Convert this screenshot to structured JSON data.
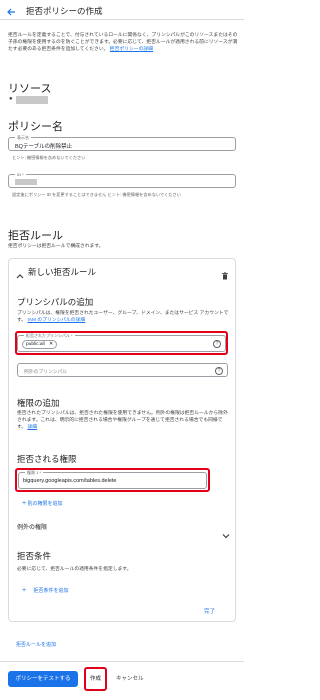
{
  "header": {
    "back_icon": "arrow-left-icon",
    "title": "拒否ポリシーの作成"
  },
  "intro": {
    "text": "拒否ルールを定義することで、付与されているロールに関係なく、プリンシパルがこのリソースまたはその子孫の権限を使用するのを防ぐことができます。必要に応じて、拒否ルールが適用される前にリソースが満たす必要のある拒否条件を追加してください。",
    "link": "拒否ポリシーの詳細"
  },
  "resource": {
    "heading": "リソース"
  },
  "policy_name": {
    "heading": "ポリシー名",
    "display_name_label": "表示名",
    "display_name_value": "BQテーブルの削除禁止",
    "display_name_hint": "ヒント: 機密情報を含めないでください",
    "id_label": "ID *",
    "id_hint": "設定後にポリシー ID を変更することはできません ヒント: 機密情報を含めないでください"
  },
  "deny_rules": {
    "heading": "拒否ルール",
    "description": "拒否ポリシーは拒否ルールで構成されます。",
    "new_rule_title": "新しい拒否ルール",
    "delete_icon": "trash-icon",
    "collapse_icon": "chevron-up-icon"
  },
  "principals": {
    "heading": "プリンシパルの追加",
    "text": "プリンシパルは、権限を拒否されたユーザー、グループ、ドメイン、またはサービス アカウントです。",
    "link": "IAM のプリンシパルの詳細",
    "denied_label": "拒否されたプリンシパル *",
    "chip_value": "public:all",
    "exception_placeholder": "例外のプリンシパル"
  },
  "permissions": {
    "heading": "権限の追加",
    "text": "拒否されたプリンシパルは、拒否された権限を使用できません。例外の権限は拒否ルールから除外されます。これは、明示的に拒否される場合や権限グループを通じて拒否される場合でも同様です。",
    "link": "詳細",
    "denied_heading": "拒否される権限",
    "permission_label": "権限 1 *",
    "permission_value": "bigquery.googleapis.com/tables.delete",
    "add_permission": "別の権限を追加",
    "exception_heading": "例外の権限"
  },
  "conditions": {
    "heading": "拒否条件",
    "text": "必要に応じて、拒否ルールの適用条件を指定します。",
    "add_condition": "拒否条件を追加",
    "done": "完了"
  },
  "add_rule": "拒否ルールを追加",
  "footer": {
    "test_button": "ポリシーをテストする",
    "create_button": "作成",
    "cancel_button": "キャンセル"
  },
  "colors": {
    "accent": "#1a73e8",
    "highlight": "#e2001a"
  }
}
